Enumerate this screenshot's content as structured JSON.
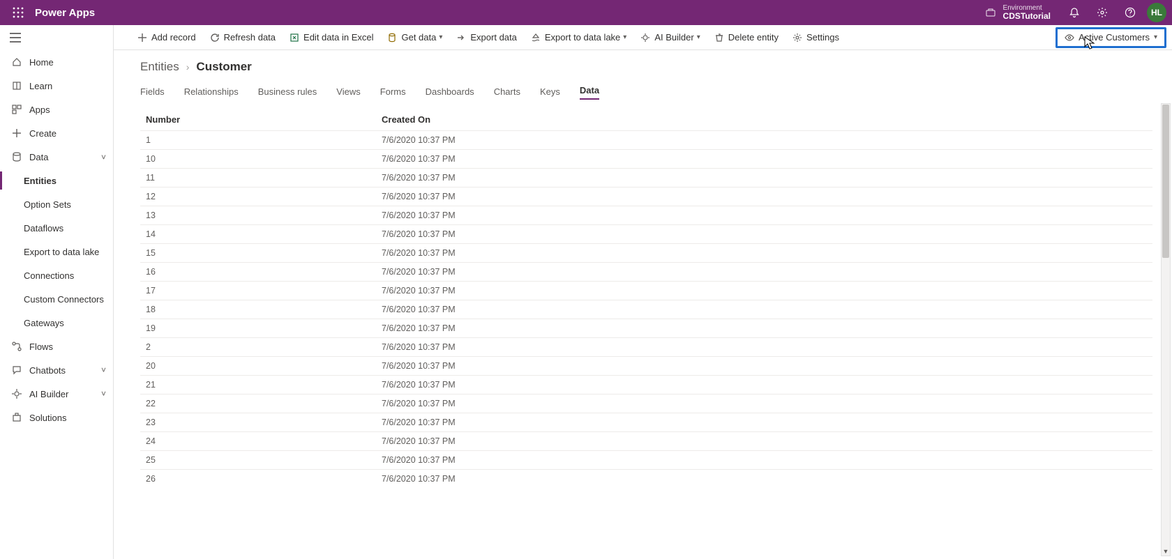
{
  "header": {
    "app_title": "Power Apps",
    "env_label": "Environment",
    "env_name": "CDSTutorial",
    "avatar_initials": "HL"
  },
  "leftnav": {
    "home": "Home",
    "learn": "Learn",
    "apps": "Apps",
    "create": "Create",
    "data": "Data",
    "data_children": {
      "entities": "Entities",
      "option_sets": "Option Sets",
      "dataflows": "Dataflows",
      "export_lake": "Export to data lake",
      "connections": "Connections",
      "custom_connectors": "Custom Connectors",
      "gateways": "Gateways"
    },
    "flows": "Flows",
    "chatbots": "Chatbots",
    "ai_builder": "AI Builder",
    "solutions": "Solutions"
  },
  "commands": {
    "add_record": "Add record",
    "refresh_data": "Refresh data",
    "edit_excel": "Edit data in Excel",
    "get_data": "Get data",
    "export_data": "Export data",
    "export_lake": "Export to data lake",
    "ai_builder": "AI Builder",
    "delete_entity": "Delete entity",
    "settings": "Settings",
    "view_selector": "Active Customers"
  },
  "breadcrumb": {
    "root": "Entities",
    "current": "Customer"
  },
  "tabs": {
    "fields": "Fields",
    "relationships": "Relationships",
    "business_rules": "Business rules",
    "views": "Views",
    "forms": "Forms",
    "dashboards": "Dashboards",
    "charts": "Charts",
    "keys": "Keys",
    "data": "Data"
  },
  "table": {
    "columns": {
      "number": "Number",
      "created_on": "Created On"
    },
    "rows": [
      {
        "number": "1",
        "created_on": "7/6/2020 10:37 PM"
      },
      {
        "number": "10",
        "created_on": "7/6/2020 10:37 PM"
      },
      {
        "number": "11",
        "created_on": "7/6/2020 10:37 PM"
      },
      {
        "number": "12",
        "created_on": "7/6/2020 10:37 PM"
      },
      {
        "number": "13",
        "created_on": "7/6/2020 10:37 PM"
      },
      {
        "number": "14",
        "created_on": "7/6/2020 10:37 PM"
      },
      {
        "number": "15",
        "created_on": "7/6/2020 10:37 PM"
      },
      {
        "number": "16",
        "created_on": "7/6/2020 10:37 PM"
      },
      {
        "number": "17",
        "created_on": "7/6/2020 10:37 PM"
      },
      {
        "number": "18",
        "created_on": "7/6/2020 10:37 PM"
      },
      {
        "number": "19",
        "created_on": "7/6/2020 10:37 PM"
      },
      {
        "number": "2",
        "created_on": "7/6/2020 10:37 PM"
      },
      {
        "number": "20",
        "created_on": "7/6/2020 10:37 PM"
      },
      {
        "number": "21",
        "created_on": "7/6/2020 10:37 PM"
      },
      {
        "number": "22",
        "created_on": "7/6/2020 10:37 PM"
      },
      {
        "number": "23",
        "created_on": "7/6/2020 10:37 PM"
      },
      {
        "number": "24",
        "created_on": "7/6/2020 10:37 PM"
      },
      {
        "number": "25",
        "created_on": "7/6/2020 10:37 PM"
      },
      {
        "number": "26",
        "created_on": "7/6/2020 10:37 PM"
      }
    ]
  }
}
